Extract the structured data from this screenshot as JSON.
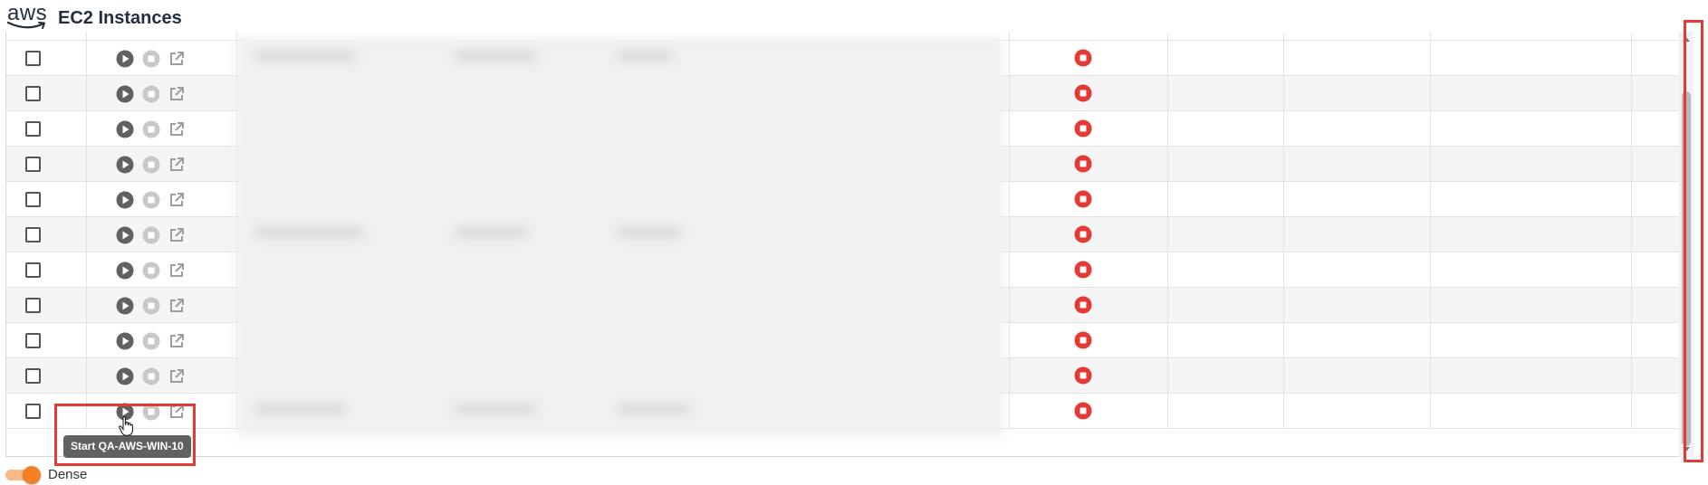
{
  "header": {
    "logo_text": "aws",
    "title": "EC2 Instances"
  },
  "table": {
    "row_count": 11,
    "row_actions": [
      "start-icon",
      "stop-icon",
      "open-external-icon"
    ],
    "status_icon": "stop-circle-icon",
    "status_color": "#e53935",
    "data_cells_blurred": true
  },
  "tooltip": {
    "text": "Start QA-AWS-WIN-10"
  },
  "footer": {
    "dense_label": "Dense",
    "dense_on": true
  },
  "colors": {
    "accent": "#f58024",
    "highlight": "#e53935",
    "brand": "#232f3e"
  }
}
